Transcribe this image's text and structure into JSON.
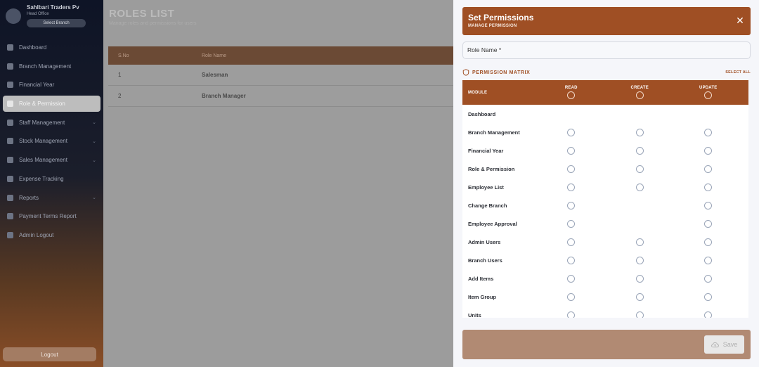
{
  "sidebar": {
    "brand_name": "Sahlbari Traders Pv",
    "brand_sub": "Head Office",
    "branch_pill": "Select Branch",
    "items": [
      {
        "label": "Dashboard",
        "icon": "dashboard-icon",
        "chevron": false,
        "active": false
      },
      {
        "label": "Branch Management",
        "icon": "branch-icon",
        "chevron": false,
        "active": false
      },
      {
        "label": "Financial Year",
        "icon": "calendar-icon",
        "chevron": false,
        "active": false
      },
      {
        "label": "Role & Permission",
        "icon": "role-icon",
        "chevron": false,
        "active": true
      },
      {
        "label": "Staff Management",
        "icon": "staff-icon",
        "chevron": true,
        "active": false
      },
      {
        "label": "Stock Management",
        "icon": "stock-icon",
        "chevron": true,
        "active": false
      },
      {
        "label": "Sales Management",
        "icon": "sales-icon",
        "chevron": true,
        "active": false
      },
      {
        "label": "Expense Tracking",
        "icon": "expense-icon",
        "chevron": false,
        "active": false
      },
      {
        "label": "Reports",
        "icon": "reports-icon",
        "chevron": true,
        "active": false
      },
      {
        "label": "Payment Terms Report",
        "icon": "payment-icon",
        "chevron": false,
        "active": false
      },
      {
        "label": "Admin Logout",
        "icon": "admin-icon",
        "chevron": false,
        "active": false
      }
    ],
    "logout_label": "Logout"
  },
  "main": {
    "title": "ROLES LIST",
    "subtitle": "Manage roles and permissions for users",
    "table": {
      "headers": [
        "S.No",
        "Role Name"
      ],
      "rows": [
        [
          "1",
          "Salesman"
        ],
        [
          "2",
          "Branch Manager"
        ]
      ]
    }
  },
  "drawer": {
    "title": "Set Permissions",
    "subtitle": "MANAGE PERMISSION",
    "role_name_label": "Role Name *",
    "matrix_title": "PERMISSION MATRIX",
    "select_all": "SELECT ALL",
    "columns": {
      "module": "MODULE",
      "read": "READ",
      "create": "CREATE",
      "update": "UPDATE"
    },
    "modules": [
      {
        "name": "Dashboard",
        "read": false,
        "create": false,
        "update": false
      },
      {
        "name": "Branch Management",
        "read": true,
        "create": true,
        "update": true
      },
      {
        "name": "Financial Year",
        "read": true,
        "create": true,
        "update": true
      },
      {
        "name": "Role & Permission",
        "read": true,
        "create": true,
        "update": true
      },
      {
        "name": "Employee List",
        "read": true,
        "create": true,
        "update": true
      },
      {
        "name": "Change Branch",
        "read": true,
        "create": false,
        "update": true
      },
      {
        "name": "Employee Approval",
        "read": true,
        "create": false,
        "update": true
      },
      {
        "name": "Admin Users",
        "read": true,
        "create": true,
        "update": true
      },
      {
        "name": "Branch Users",
        "read": true,
        "create": true,
        "update": true
      },
      {
        "name": "Add Items",
        "read": true,
        "create": true,
        "update": true
      },
      {
        "name": "Item Group",
        "read": true,
        "create": true,
        "update": true
      },
      {
        "name": "Units",
        "read": true,
        "create": true,
        "update": true
      }
    ],
    "save_label": "Save"
  },
  "colors": {
    "accent": "#9f4f24",
    "footer": "#b18a73",
    "overlay_gray": "#9c9c9c"
  }
}
